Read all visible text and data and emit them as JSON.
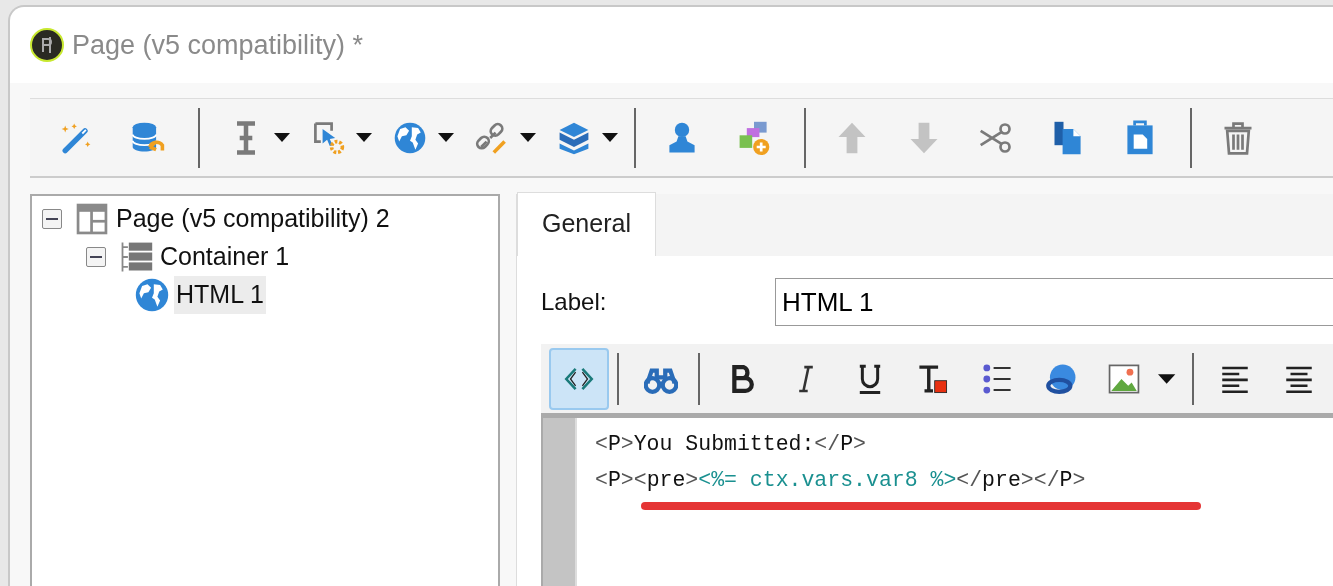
{
  "window": {
    "title": "Page (v5 compatibility) *"
  },
  "toolbar": [
    {
      "kind": "wand",
      "disabled": false
    },
    {
      "kind": "database",
      "disabled": false
    },
    {
      "kind": "separator"
    },
    {
      "kind": "ibeam",
      "dropdown": true,
      "disabled": false
    },
    {
      "kind": "cursor",
      "dropdown": true,
      "disabled": false
    },
    {
      "kind": "globe",
      "dropdown": true,
      "disabled": false
    },
    {
      "kind": "link",
      "dropdown": true,
      "disabled": false
    },
    {
      "kind": "box",
      "dropdown": true,
      "disabled": false
    },
    {
      "kind": "separator"
    },
    {
      "kind": "person",
      "disabled": false
    },
    {
      "kind": "shapes",
      "disabled": false
    },
    {
      "kind": "separator"
    },
    {
      "kind": "up",
      "disabled": true
    },
    {
      "kind": "down",
      "disabled": true
    },
    {
      "kind": "scissors",
      "disabled": false
    },
    {
      "kind": "copy",
      "disabled": false
    },
    {
      "kind": "paste",
      "disabled": false
    },
    {
      "kind": "separator"
    },
    {
      "kind": "trash",
      "disabled": false
    }
  ],
  "tree": [
    {
      "label": "Page (v5 compatibility) 2",
      "kind": "page",
      "expanded": true,
      "selected": false,
      "children": [
        {
          "label": "Container 1",
          "kind": "container",
          "expanded": true,
          "selected": false,
          "children": [
            {
              "label": "HTML 1",
              "kind": "html",
              "selected": true
            }
          ]
        }
      ]
    }
  ],
  "tabs": [
    {
      "label": "General",
      "selected": true
    }
  ],
  "label_field": {
    "label": "Label:",
    "value": "HTML 1"
  },
  "editor_toolbar": [
    {
      "kind": "source",
      "selected": true
    },
    {
      "kind": "separator"
    },
    {
      "kind": "find",
      "selected": false
    },
    {
      "kind": "separator"
    },
    {
      "kind": "bold",
      "selected": false
    },
    {
      "kind": "italic",
      "selected": false
    },
    {
      "kind": "underline",
      "selected": false
    },
    {
      "kind": "textcolor",
      "selected": false
    },
    {
      "kind": "list",
      "selected": false
    },
    {
      "kind": "weblink",
      "selected": false
    },
    {
      "kind": "image",
      "selected": false,
      "dropdown": true
    },
    {
      "kind": "separator"
    },
    {
      "kind": "alignleft",
      "selected": false
    },
    {
      "kind": "aligncenter",
      "selected": false
    }
  ],
  "code_lines": [
    {
      "segments": [
        {
          "kind": "bracket",
          "text": "<"
        },
        {
          "kind": "tag",
          "text": "P"
        },
        {
          "kind": "bracket",
          "text": ">"
        },
        {
          "kind": "text",
          "text": "You Submitted:"
        },
        {
          "kind": "bracket",
          "text": "</"
        },
        {
          "kind": "tag",
          "text": "P"
        },
        {
          "kind": "bracket",
          "text": ">"
        }
      ]
    },
    {
      "underlined": true,
      "segments": [
        {
          "kind": "bracket",
          "text": "<"
        },
        {
          "kind": "tag",
          "text": "P"
        },
        {
          "kind": "bracket",
          "text": "><"
        },
        {
          "kind": "tag",
          "text": "pre"
        },
        {
          "kind": "bracket",
          "text": ">"
        },
        {
          "kind": "expr",
          "text": "<%= ctx.vars.var8 %>"
        },
        {
          "kind": "bracket",
          "text": "</"
        },
        {
          "kind": "tag",
          "text": "pre"
        },
        {
          "kind": "bracket",
          "text": "></"
        },
        {
          "kind": "tag",
          "text": "P"
        },
        {
          "kind": "bracket",
          "text": ">"
        }
      ]
    }
  ]
}
